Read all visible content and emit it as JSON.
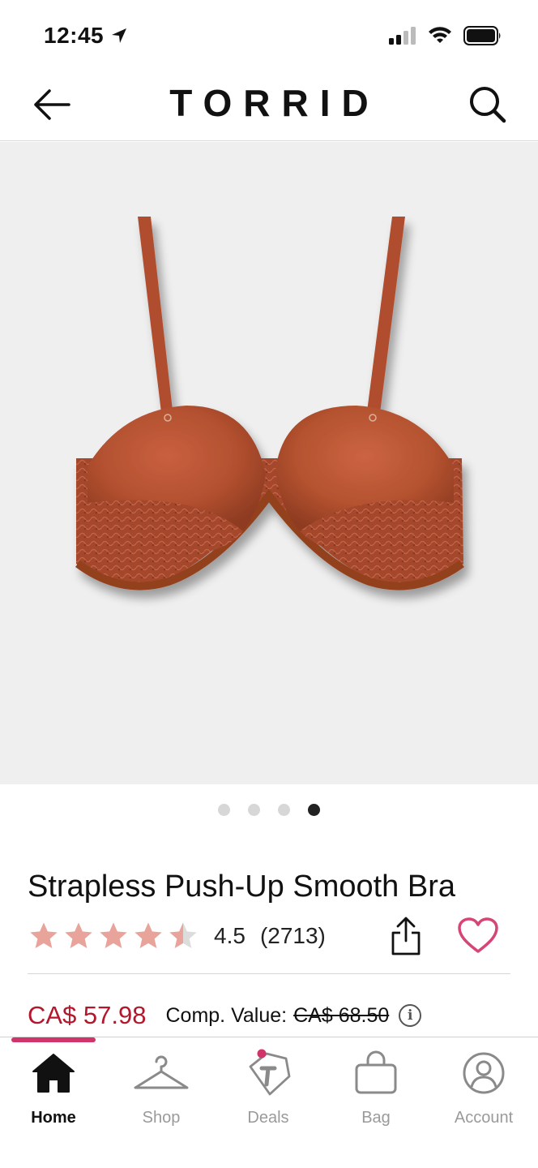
{
  "status_bar": {
    "time": "12:45",
    "icons": [
      "location-arrow-icon",
      "signal-icon",
      "wifi-icon",
      "battery-icon"
    ]
  },
  "header": {
    "logo": "TORRID",
    "back_icon": "arrow-left-icon",
    "search_icon": "search-icon"
  },
  "product": {
    "image_alt": "Strapless Push-Up Smooth Bra in rust",
    "image_count": 4,
    "active_image_index": 3,
    "title": "Strapless Push-Up Smooth Bra",
    "rating": 4.5,
    "rating_display": "4.5",
    "review_count": "(2713)",
    "sale_price": "CA$ 57.98",
    "comp_label": "Comp. Value:",
    "comp_value": "CA$ 68.50",
    "info_glyph": "i"
  },
  "colors": {
    "star_fill": "#e8a39a",
    "star_empty": "#dcdcdc",
    "sale_price": "#b4172c",
    "accent_pink": "#d0346a",
    "product": "#a84a33",
    "image_bg": "#efefef"
  },
  "bottom_nav": {
    "items": [
      {
        "label": "Home",
        "icon": "home-icon",
        "active": true
      },
      {
        "label": "Shop",
        "icon": "hanger-icon",
        "active": false
      },
      {
        "label": "Deals",
        "icon": "tag-icon",
        "active": false
      },
      {
        "label": "Bag",
        "icon": "bag-icon",
        "active": false
      },
      {
        "label": "Account",
        "icon": "account-icon",
        "active": false
      }
    ]
  }
}
